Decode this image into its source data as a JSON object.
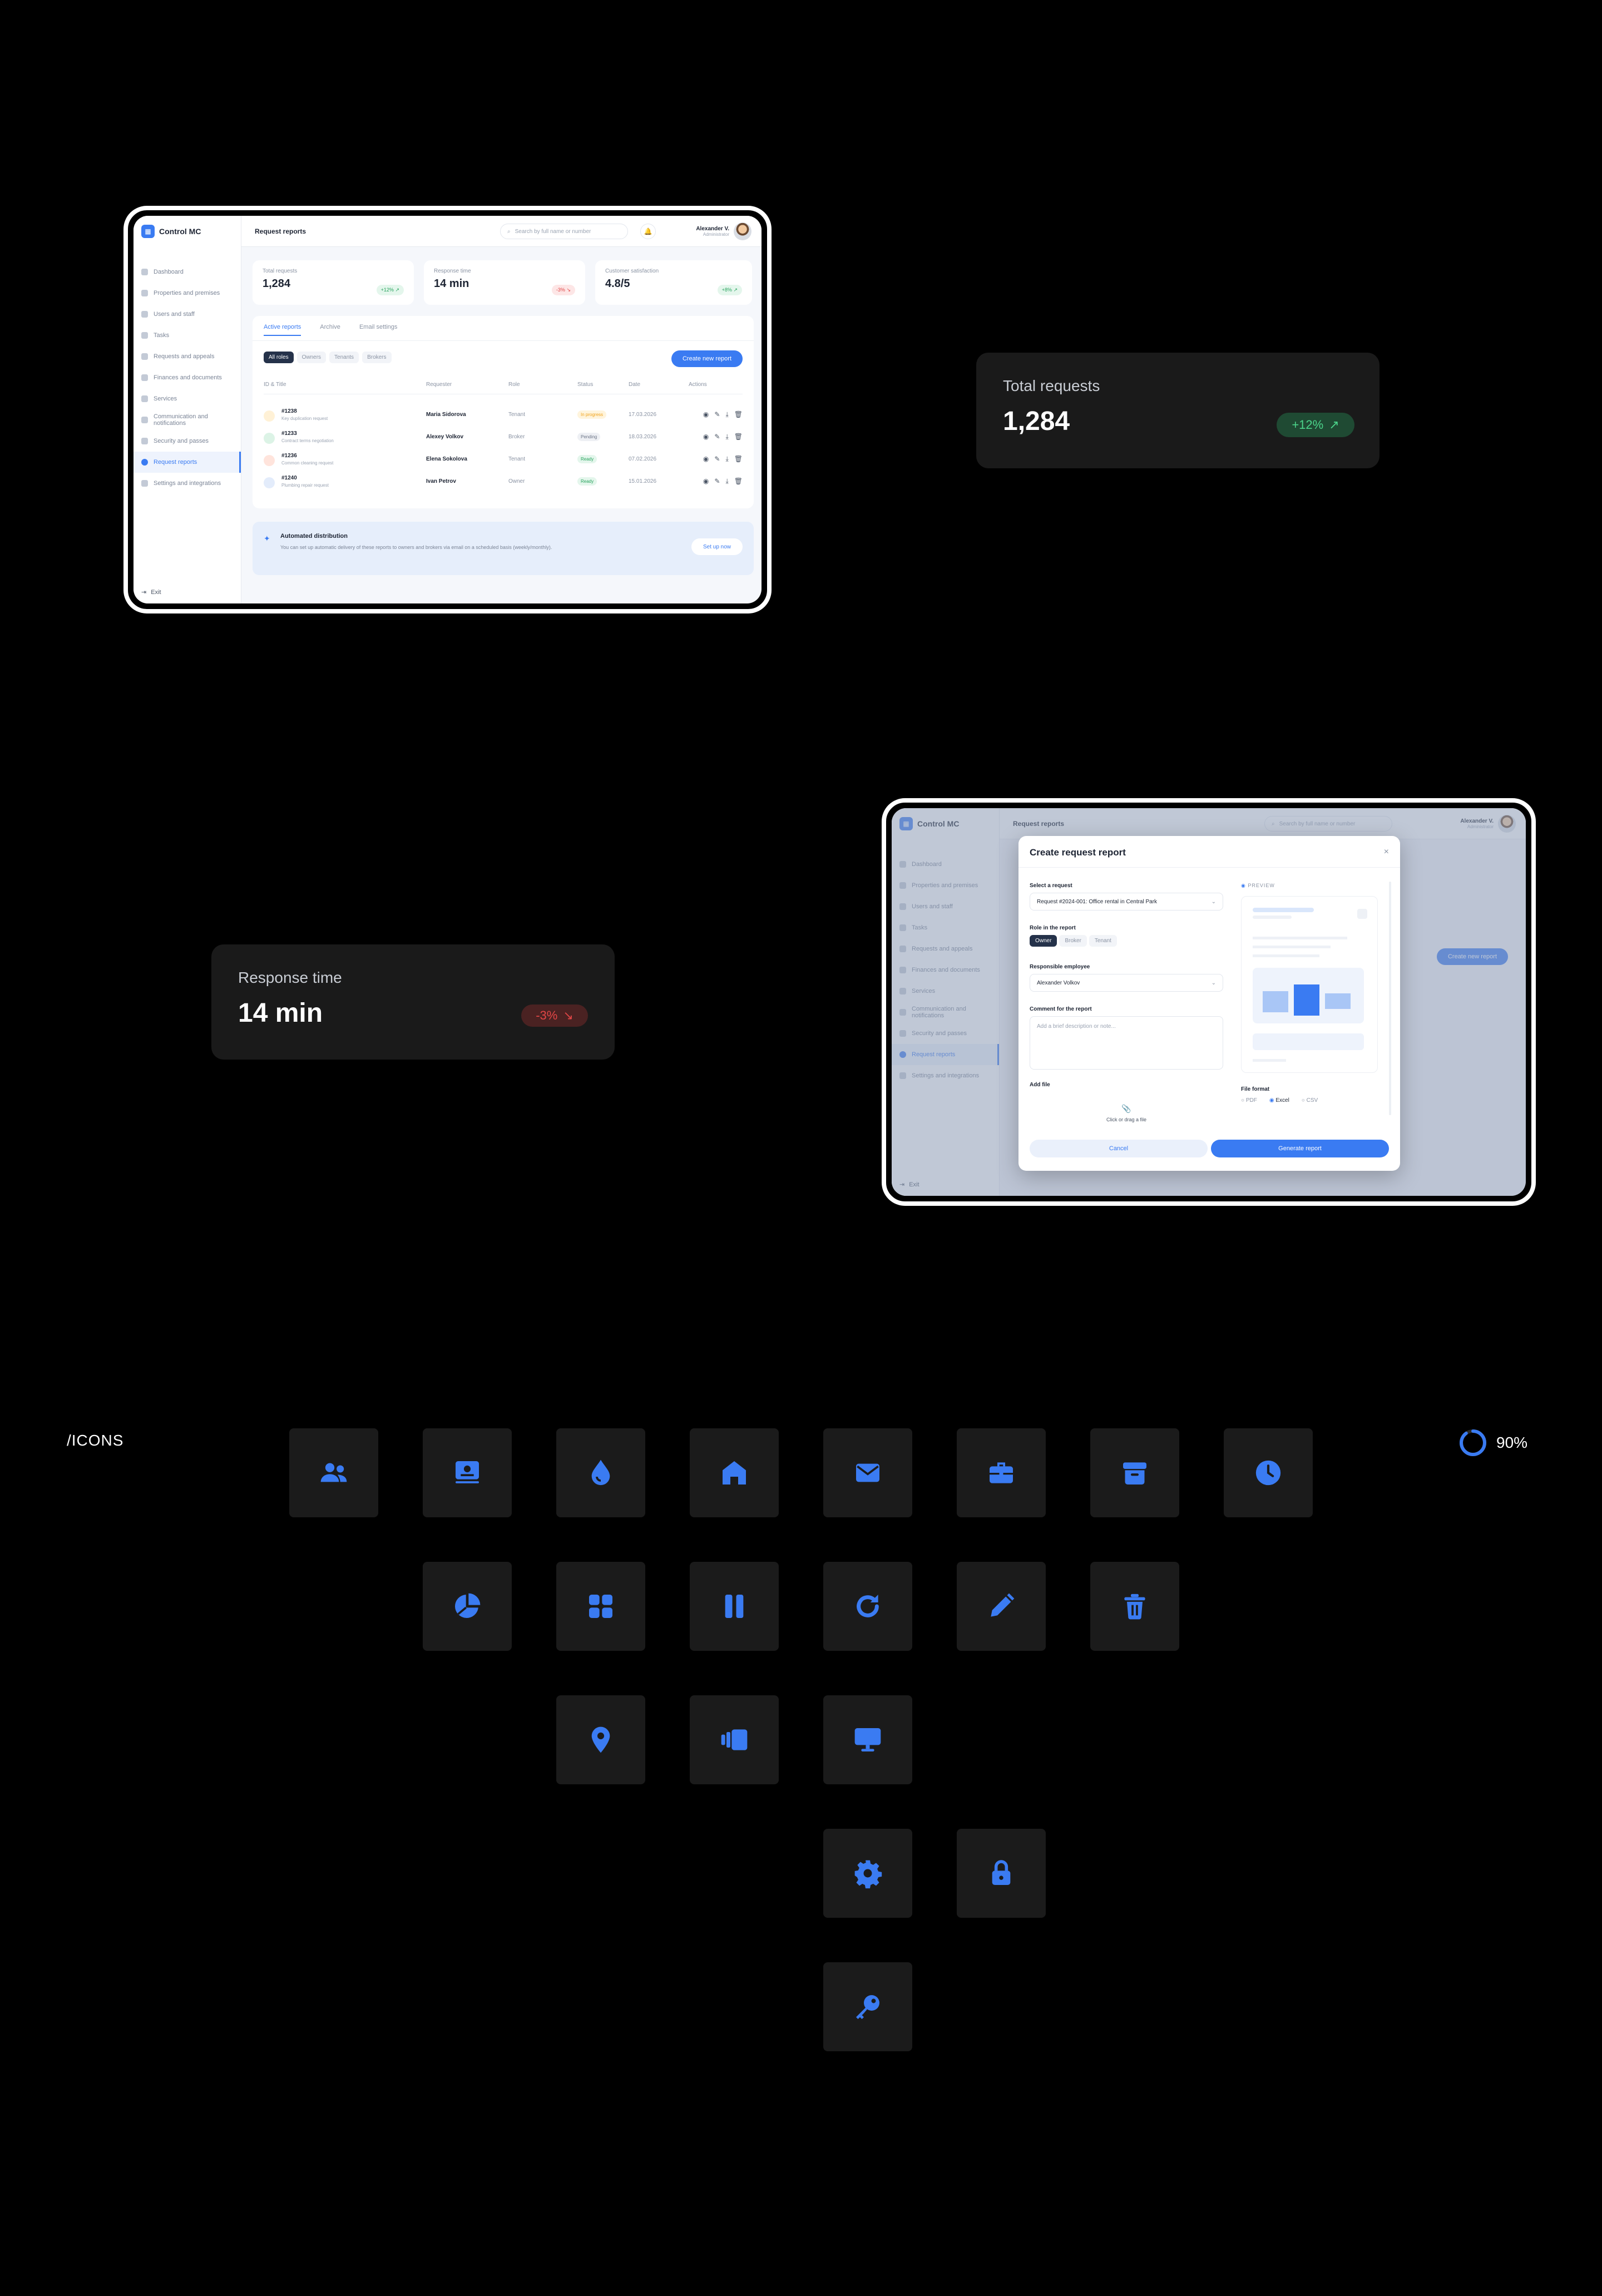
{
  "app": {
    "name": "Control MC",
    "page_title": "Request reports",
    "search_placeholder": "Search by full name or number",
    "user_name": "Alexander V.",
    "user_role": "Administrator",
    "exit": "Exit"
  },
  "sidebar": {
    "items": [
      {
        "label": "Dashboard"
      },
      {
        "label": "Properties and premises"
      },
      {
        "label": "Users and staff"
      },
      {
        "label": "Tasks"
      },
      {
        "label": "Requests and appeals"
      },
      {
        "label": "Finances and documents"
      },
      {
        "label": "Services"
      },
      {
        "label": "Communication and notifications"
      },
      {
        "label": "Security and passes"
      },
      {
        "label": "Request reports"
      },
      {
        "label": "Settings and integrations"
      }
    ]
  },
  "kpis": [
    {
      "label": "Total requests",
      "value": "1,284",
      "delta": "+12%"
    },
    {
      "label": "Response time",
      "value": "14 min",
      "delta": "-3%"
    },
    {
      "label": "Customer satisfaction",
      "value": "4.8/5",
      "delta": "+8%"
    }
  ],
  "reports": {
    "tabs": [
      "Active reports",
      "Archive",
      "Email settings"
    ],
    "filters": [
      "All roles",
      "Owners",
      "Tenants",
      "Brokers"
    ],
    "create_button": "Create new report",
    "columns": [
      "ID & Title",
      "Requester",
      "Role",
      "Status",
      "Date",
      "Actions"
    ],
    "rows": [
      {
        "id": "#1238",
        "title": "Key duplication request",
        "requester": "Maria Sidorova",
        "role": "Tenant",
        "status": "In progress",
        "date": "17.03.2026"
      },
      {
        "id": "#1233",
        "title": "Contract terms negotiation",
        "requester": "Alexey Volkov",
        "role": "Broker",
        "status": "Pending",
        "date": "18.03.2026"
      },
      {
        "id": "#1236",
        "title": "Common cleaning request",
        "requester": "Elena Sokolova",
        "role": "Tenant",
        "status": "Ready",
        "date": "07.02.2026"
      },
      {
        "id": "#1240",
        "title": "Plumbing repair request",
        "requester": "Ivan Petrov",
        "role": "Owner",
        "status": "Ready",
        "date": "15.01.2026"
      }
    ]
  },
  "automation": {
    "title": "Automated distribution",
    "text": "You can set up automatic delivery of these reports to owners and brokers via email on a scheduled basis (weekly/monthly).",
    "button": "Set up now"
  },
  "modal": {
    "title": "Create request report",
    "select_label": "Select a request",
    "select_value": "Request #2024-001: Office rental in Central Park",
    "role_label": "Role in the report",
    "roles": [
      "Owner",
      "Broker",
      "Tenant"
    ],
    "employee_label": "Responsible employee",
    "employee_value": "Alexander Volkov",
    "comment_label": "Comment for the report",
    "comment_placeholder": "Add a brief description or note...",
    "file_label": "Add file",
    "file_hint": "Click or drag a file",
    "preview_label": "PREVIEW",
    "format_label": "File format",
    "formats": [
      "PDF",
      "Excel",
      "CSV"
    ],
    "cancel": "Cancel",
    "generate": "Generate report"
  },
  "section": {
    "icons_title": "/ICONS",
    "progress": "90%"
  },
  "icons": [
    "users-icon",
    "id-card-icon",
    "drop-icon",
    "home-icon",
    "mail-icon",
    "briefcase-icon",
    "archive-icon",
    "clock-icon",
    "pie-chart-icon",
    "grid-icon",
    "pause-icon",
    "refresh-icon",
    "pencil-icon",
    "trash-icon",
    "map-pin-icon",
    "cards-icon",
    "monitor-icon",
    "gear-icon",
    "lock-icon",
    "key-icon"
  ],
  "colors": {
    "accent": "#3a7bf2",
    "success": "#27a35c",
    "danger": "#e24646",
    "warning": "#f0a21a",
    "tile": "#1b1b1b"
  }
}
